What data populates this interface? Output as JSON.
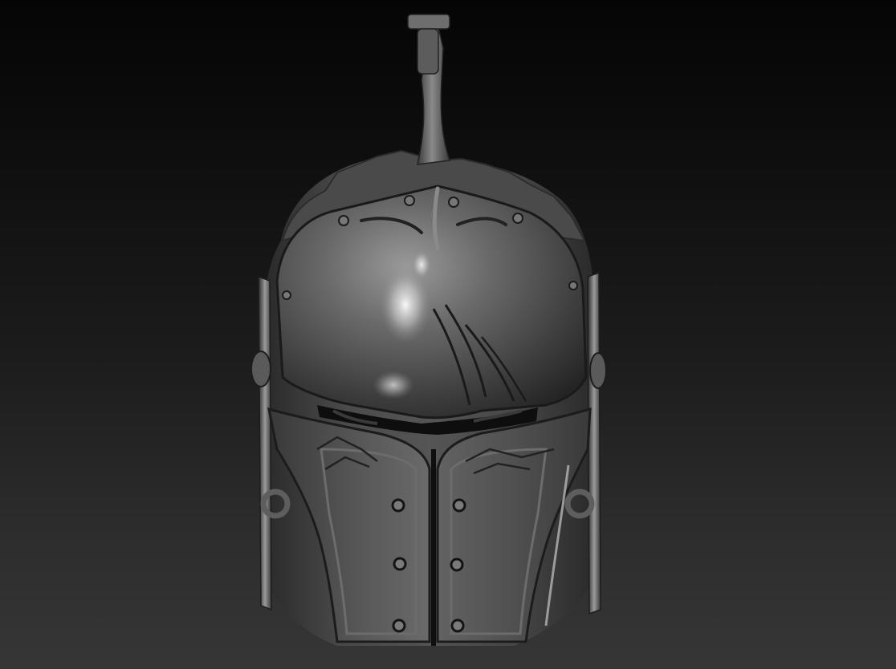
{
  "viewport": {
    "background_top": "#050505",
    "background_bottom": "#363636"
  },
  "model": {
    "subject": "knight-helmet-sculpt",
    "material_base": "#5a5a5a",
    "material_highlight": "#cfcfcf",
    "material_shadow": "#161616"
  }
}
